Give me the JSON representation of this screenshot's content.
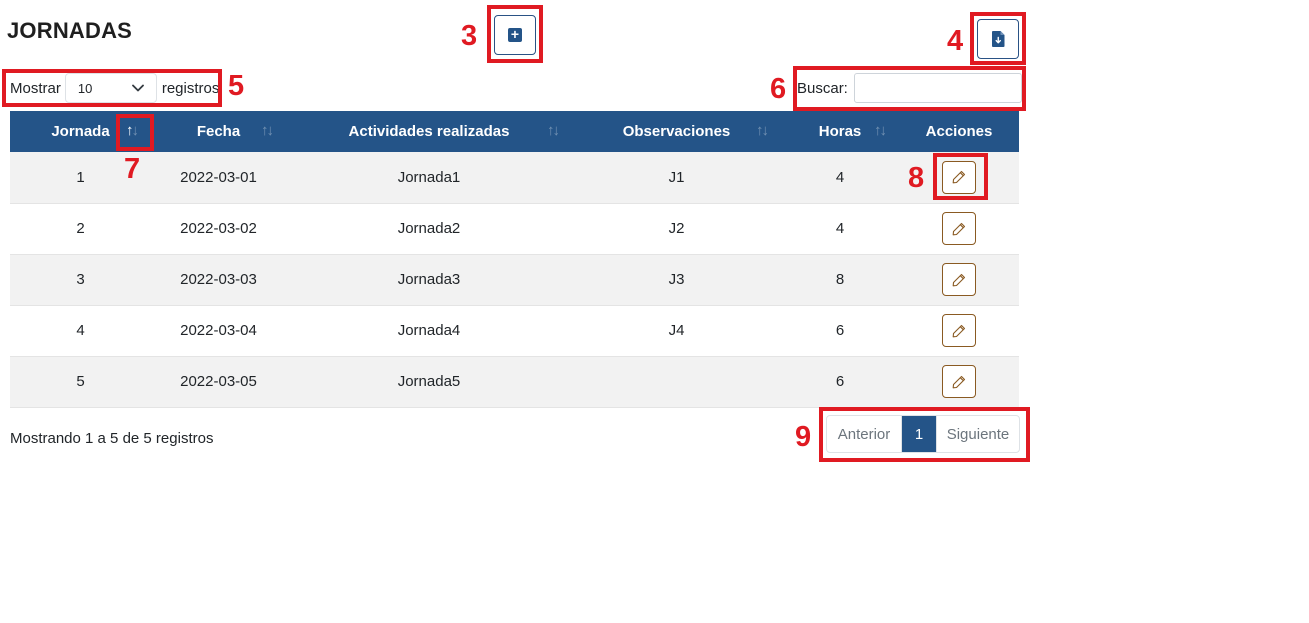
{
  "page": {
    "title": "JORNADAS"
  },
  "toolbar": {
    "add_icon": "plus-square-icon",
    "export_icon": "file-download-icon"
  },
  "length": {
    "prefix": "Mostrar",
    "selected": "10",
    "suffix": "registros"
  },
  "search": {
    "label": "Buscar:",
    "value": "",
    "placeholder": ""
  },
  "table": {
    "columns": [
      "Jornada",
      "Fecha",
      "Actividades realizadas",
      "Observaciones",
      "Horas",
      "Acciones"
    ],
    "rows": [
      {
        "jornada": "1",
        "fecha": "2022-03-01",
        "actividades": "Jornada1",
        "observaciones": "J1",
        "horas": "4"
      },
      {
        "jornada": "2",
        "fecha": "2022-03-02",
        "actividades": "Jornada2",
        "observaciones": "J2",
        "horas": "4"
      },
      {
        "jornada": "3",
        "fecha": "2022-03-03",
        "actividades": "Jornada3",
        "observaciones": "J3",
        "horas": "8"
      },
      {
        "jornada": "4",
        "fecha": "2022-03-04",
        "actividades": "Jornada4",
        "observaciones": "J4",
        "horas": "6"
      },
      {
        "jornada": "5",
        "fecha": "2022-03-05",
        "actividades": "Jornada5",
        "observaciones": "",
        "horas": "6"
      }
    ]
  },
  "info": "Mostrando 1 a 5 de 5 registros",
  "pagination": {
    "prev": "Anterior",
    "current": "1",
    "next": "Siguiente"
  },
  "annotations": [
    "3",
    "4",
    "5",
    "6",
    "7",
    "8",
    "9"
  ],
  "colors": {
    "header": "#245488",
    "annotation": "#e01a22",
    "edit_border": "#8a5a22"
  }
}
